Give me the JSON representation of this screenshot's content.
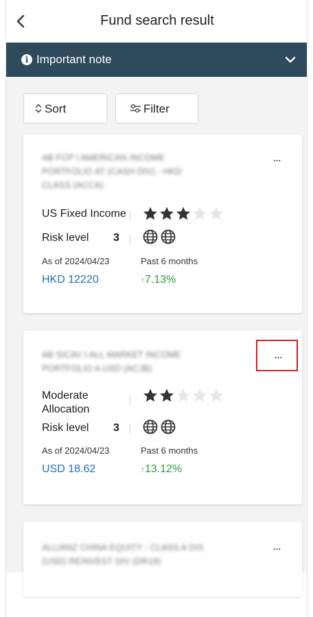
{
  "header": {
    "title": "Fund search result"
  },
  "note_bar": {
    "label": "Important note"
  },
  "toolbar": {
    "sort_label": "Sort",
    "filter_label": "Filter"
  },
  "funds": [
    {
      "name_line1": "AB FCP I AMERICAN INCOME",
      "name_line2": "PORTFOLIO AT (CASH DIV) - HKD",
      "name_line3": "CLASS (ACCA)",
      "category_line1": "US Fixed Income",
      "category_line2": "",
      "rating": 3,
      "rating_max": 5,
      "risk_label": "Risk level",
      "risk_level": "3",
      "globes": 2,
      "as_of": "As of 2024/04/23",
      "period": "Past 6 months",
      "price": "HKD 12220",
      "change": "7.13%"
    },
    {
      "name_line1": "AB SICAV I ALL MARKET INCOME",
      "name_line2": "PORTFOLIO A USD (ACJB)",
      "name_line3": "",
      "category_line1": "Moderate",
      "category_line2": "Allocation",
      "rating": 2,
      "rating_max": 5,
      "risk_label": "Risk level",
      "risk_level": "3",
      "globes": 2,
      "as_of": "As of 2024/04/23",
      "period": "Past 6 months",
      "price": "USD 18.62",
      "change": "13.12%"
    },
    {
      "name_line1": "ALLIANZ CHINA EQUITY - CLASS A DIS",
      "name_line2": "(USD) REINVEST DIV (DR18)",
      "name_line3": ""
    }
  ],
  "more_label": "…",
  "change_arrow": "↑",
  "colors": {
    "note_bar": "#2e4a5c",
    "price": "#1d6fb8",
    "change": "#2e9a3a",
    "star_filled": "#333333",
    "star_empty": "#e6e6e6",
    "highlight": "#cc2222"
  }
}
